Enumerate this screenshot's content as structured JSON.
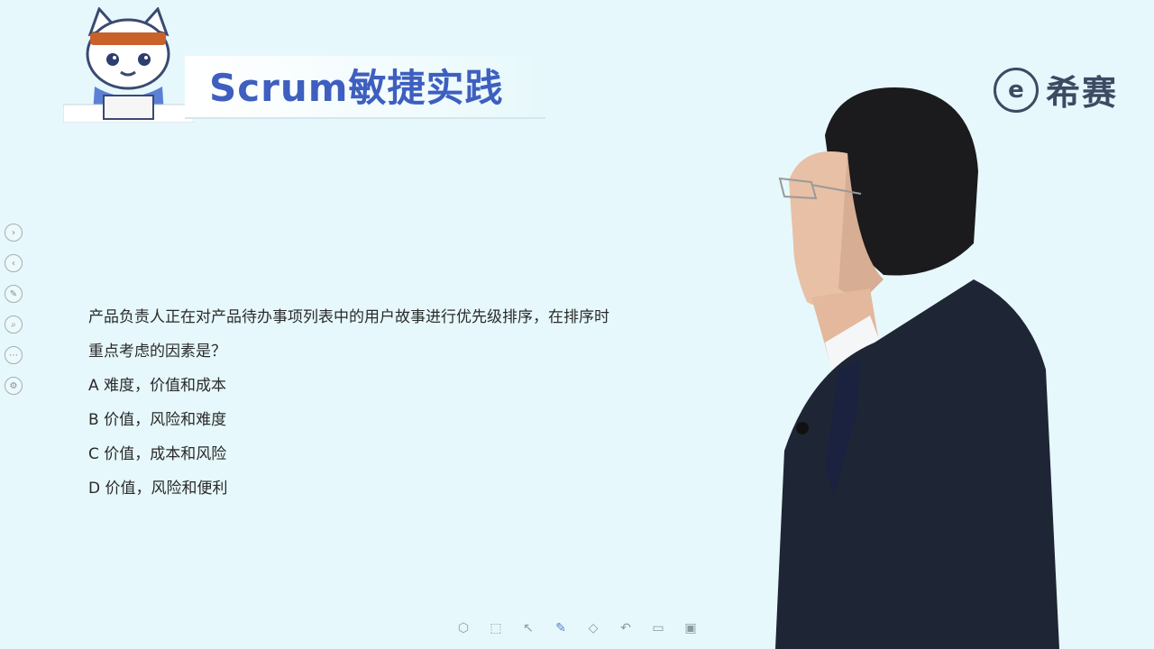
{
  "header": {
    "course_title": "Scrum敏捷实践",
    "brand_name": "希赛",
    "brand_logo_glyph": "e"
  },
  "question": {
    "stem_line1": "产品负责人正在对产品待办事项列表中的用户故事进行优先级排序，在排序时",
    "stem_line2": "重点考虑的因素是？",
    "options": [
      "A 难度，价值和成本",
      "B 价值，风险和难度",
      "C 价值，成本和风险",
      "D 价值，风险和便利"
    ]
  },
  "left_toolbar": {
    "icons": [
      "forward-icon",
      "back-icon",
      "pen-icon",
      "zoom-icon",
      "more-icon",
      "settings-icon"
    ]
  },
  "bottom_toolbar": {
    "icons": [
      "shape-icon",
      "select-icon",
      "pointer-icon",
      "pen-icon",
      "eraser-icon",
      "undo-icon",
      "comment-icon",
      "screen-icon"
    ]
  },
  "colors": {
    "background": "#e6f8fb",
    "title_blue": "#3e5fbf",
    "brand_dark": "#3d4a63",
    "suit": "#1e2535"
  }
}
